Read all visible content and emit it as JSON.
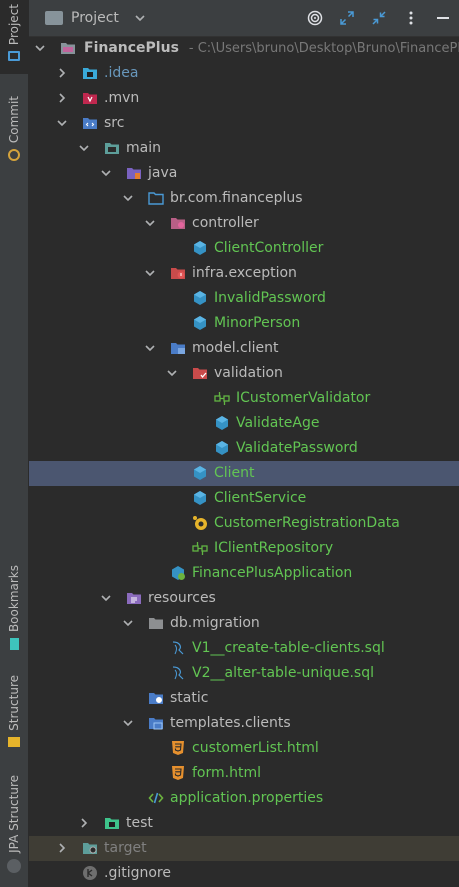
{
  "sidebar": {
    "top": [
      {
        "label": "Project",
        "active": true,
        "icon": "project-window-icon"
      },
      {
        "label": "Commit",
        "active": false,
        "icon": "commit-icon"
      }
    ],
    "bottom": [
      {
        "label": "Bookmarks",
        "icon": "bookmark-icon"
      },
      {
        "label": "Structure",
        "icon": "structure-icon"
      },
      {
        "label": "JPA Structure",
        "icon": "jpa-icon"
      }
    ]
  },
  "header": {
    "title": "Project",
    "tools": [
      "target-icon",
      "expand-all-icon",
      "collapse-all-icon",
      "more-options-icon",
      "hide-icon"
    ]
  },
  "tree": {
    "root_label": "FinancePlus",
    "root_path": "- C:\\Users\\bruno\\Desktop\\Bruno\\FinancePl",
    "items": [
      {
        "label": ".idea",
        "icon": "idea-folder-icon",
        "color": "#6897bb",
        "depth": 1,
        "state": "collapsed"
      },
      {
        "label": ".mvn",
        "icon": "mvn-folder-icon",
        "color": "#bbbbbb",
        "depth": 1,
        "state": "collapsed"
      },
      {
        "label": "src",
        "icon": "source-folder-icon",
        "color": "#bbbbbb",
        "depth": 1,
        "state": "expanded"
      },
      {
        "label": "main",
        "icon": "module-folder-icon",
        "color": "#bbbbbb",
        "depth": 2,
        "state": "expanded"
      },
      {
        "label": "java",
        "icon": "java-source-folder-icon",
        "color": "#bbbbbb",
        "depth": 3,
        "state": "expanded"
      },
      {
        "label": "br.com.financeplus",
        "icon": "package-icon",
        "color": "#bbbbbb",
        "depth": 4,
        "state": "expanded"
      },
      {
        "label": "controller",
        "icon": "controller-package-icon",
        "color": "#bbbbbb",
        "depth": 5,
        "state": "expanded"
      },
      {
        "label": "ClientController",
        "icon": "class-icon",
        "color": "#62c553",
        "depth": 6,
        "state": "leaf"
      },
      {
        "label": "infra.exception",
        "icon": "exception-package-icon",
        "color": "#bbbbbb",
        "depth": 5,
        "state": "expanded"
      },
      {
        "label": "InvalidPassword",
        "icon": "class-icon",
        "color": "#62c553",
        "depth": 6,
        "state": "leaf"
      },
      {
        "label": "MinorPerson",
        "icon": "class-icon",
        "color": "#62c553",
        "depth": 6,
        "state": "leaf"
      },
      {
        "label": "model.client",
        "icon": "model-package-icon",
        "color": "#bbbbbb",
        "depth": 5,
        "state": "expanded"
      },
      {
        "label": "validation",
        "icon": "validation-package-icon",
        "color": "#bbbbbb",
        "depth": 6,
        "state": "expanded"
      },
      {
        "label": "ICustomerValidator",
        "icon": "interface-icon",
        "color": "#62c553",
        "depth": 7,
        "state": "leaf"
      },
      {
        "label": "ValidateAge",
        "icon": "class-icon",
        "color": "#62c553",
        "depth": 7,
        "state": "leaf"
      },
      {
        "label": "ValidatePassword",
        "icon": "class-icon",
        "color": "#62c553",
        "depth": 7,
        "state": "leaf"
      },
      {
        "label": "Client",
        "icon": "class-icon",
        "color": "#62c553",
        "depth": 6,
        "state": "leaf",
        "selected": true
      },
      {
        "label": "ClientService",
        "icon": "class-icon",
        "color": "#62c553",
        "depth": 6,
        "state": "leaf"
      },
      {
        "label": "CustomerRegistrationData",
        "icon": "record-icon",
        "color": "#62c553",
        "depth": 6,
        "state": "leaf"
      },
      {
        "label": "IClientRepository",
        "icon": "interface-icon",
        "color": "#62c553",
        "depth": 6,
        "state": "leaf"
      },
      {
        "label": "FinancePlusApplication",
        "icon": "spring-app-icon",
        "color": "#62c553",
        "depth": 5,
        "state": "leaf"
      },
      {
        "label": "resources",
        "icon": "resources-folder-icon",
        "color": "#bbbbbb",
        "depth": 3,
        "state": "expanded"
      },
      {
        "label": "db.migration",
        "icon": "folder-icon",
        "color": "#bbbbbb",
        "depth": 4,
        "state": "expanded"
      },
      {
        "label": "V1__create-table-clients.sql",
        "icon": "sql-file-icon",
        "color": "#62c553",
        "depth": 5,
        "state": "leaf"
      },
      {
        "label": "V2__alter-table-unique.sql",
        "icon": "sql-file-icon",
        "color": "#62c553",
        "depth": 5,
        "state": "leaf"
      },
      {
        "label": "static",
        "icon": "web-folder-icon",
        "color": "#bbbbbb",
        "depth": 4,
        "state": "leaf"
      },
      {
        "label": "templates.clients",
        "icon": "template-folder-icon",
        "color": "#bbbbbb",
        "depth": 4,
        "state": "expanded"
      },
      {
        "label": "customerList.html",
        "icon": "html-file-icon",
        "color": "#62c553",
        "depth": 5,
        "state": "leaf"
      },
      {
        "label": "form.html",
        "icon": "html-file-icon",
        "color": "#62c553",
        "depth": 5,
        "state": "leaf"
      },
      {
        "label": "application.properties",
        "icon": "properties-file-icon",
        "color": "#62c553",
        "depth": 4,
        "state": "leaf"
      },
      {
        "label": "test",
        "icon": "test-folder-icon",
        "color": "#bbbbbb",
        "depth": 2,
        "state": "collapsed"
      },
      {
        "label": "target",
        "icon": "target-folder-icon",
        "color": "#808080",
        "depth": 1,
        "state": "collapsed",
        "excluded": true
      },
      {
        "label": ".gitignore",
        "icon": "gitignore-file-icon",
        "color": "#bbbbbb",
        "depth": 1,
        "state": "leaf"
      }
    ]
  }
}
